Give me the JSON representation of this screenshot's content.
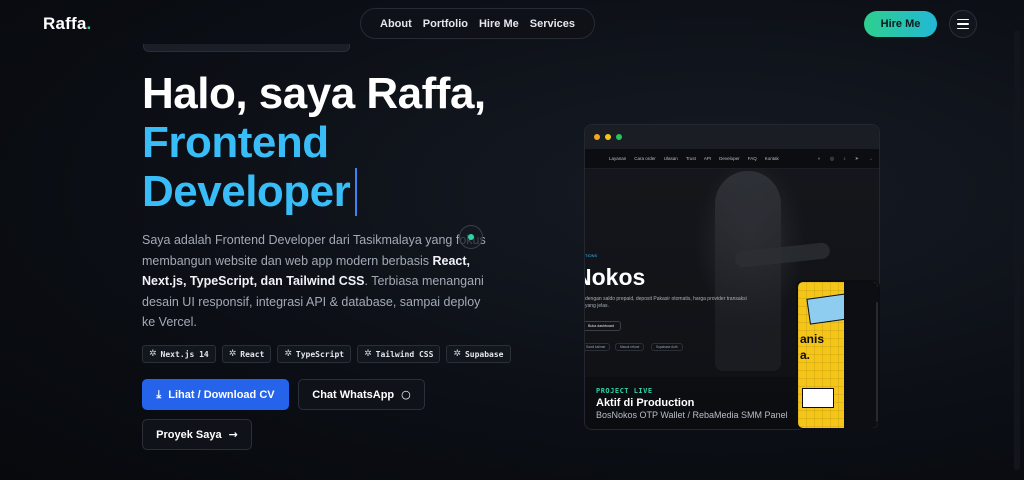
{
  "brand": {
    "name": "Raffa",
    "dot": "."
  },
  "nav": {
    "items": [
      {
        "label": "About"
      },
      {
        "label": "Portfolio"
      },
      {
        "label": "Hire Me"
      },
      {
        "label": "Services"
      }
    ],
    "hire_label": "Hire Me",
    "menu_icon": "hamburger-menu-icon"
  },
  "hero": {
    "greeting": "Halo, saya Raffa,",
    "role_line1": "Frontend",
    "role_line2": "Developer",
    "desc_part1": "Saya adalah Frontend Developer dari Tasikmalaya yang fokus membangun website dan web app modern berbasis ",
    "desc_strong": "React, Next.js, TypeScript, dan Tailwind CSS",
    "desc_part2": ". Terbiasa menangani desain UI responsif, integrasi API & database, sampai deploy ke Vercel."
  },
  "tags": [
    {
      "label": "Next.js 14"
    },
    {
      "label": "React"
    },
    {
      "label": "TypeScript"
    },
    {
      "label": "Tailwind CSS"
    },
    {
      "label": "Supabase"
    }
  ],
  "buttons": {
    "cv": "Lihat / Download CV",
    "whatsapp": "Chat WhatsApp",
    "projects": "Proyek Saya"
  },
  "preview": {
    "subnav": [
      "Layanan",
      "Cara order",
      "Ulasan",
      "Trust",
      "API",
      "Developer",
      "FAQ",
      "Kontak"
    ],
    "heading": "Nokos",
    "eyebrow": "TIONS",
    "body": "dengan saldo prepaid, deposit Pakasir otomatis, harga provider transaksi yang jelas.",
    "cta": "Buka dashboard",
    "minis": [
      "Sandi kalimat",
      "Masuk refund",
      "Supabase Auth"
    ],
    "tag": "PROJECT LIVE",
    "title": "Aktif di Production",
    "subtitle": "BosNokos OTP Wallet / RebaMedia SMM Panel",
    "phone_word1": "anis",
    "phone_word2": "a."
  },
  "colors": {
    "accent_blue": "#38bdf8",
    "primary_button": "#2563eb",
    "hire_gradient_start": "#2ecf8f",
    "hire_gradient_end": "#22b8d6",
    "live_green": "#2dd4a7"
  }
}
